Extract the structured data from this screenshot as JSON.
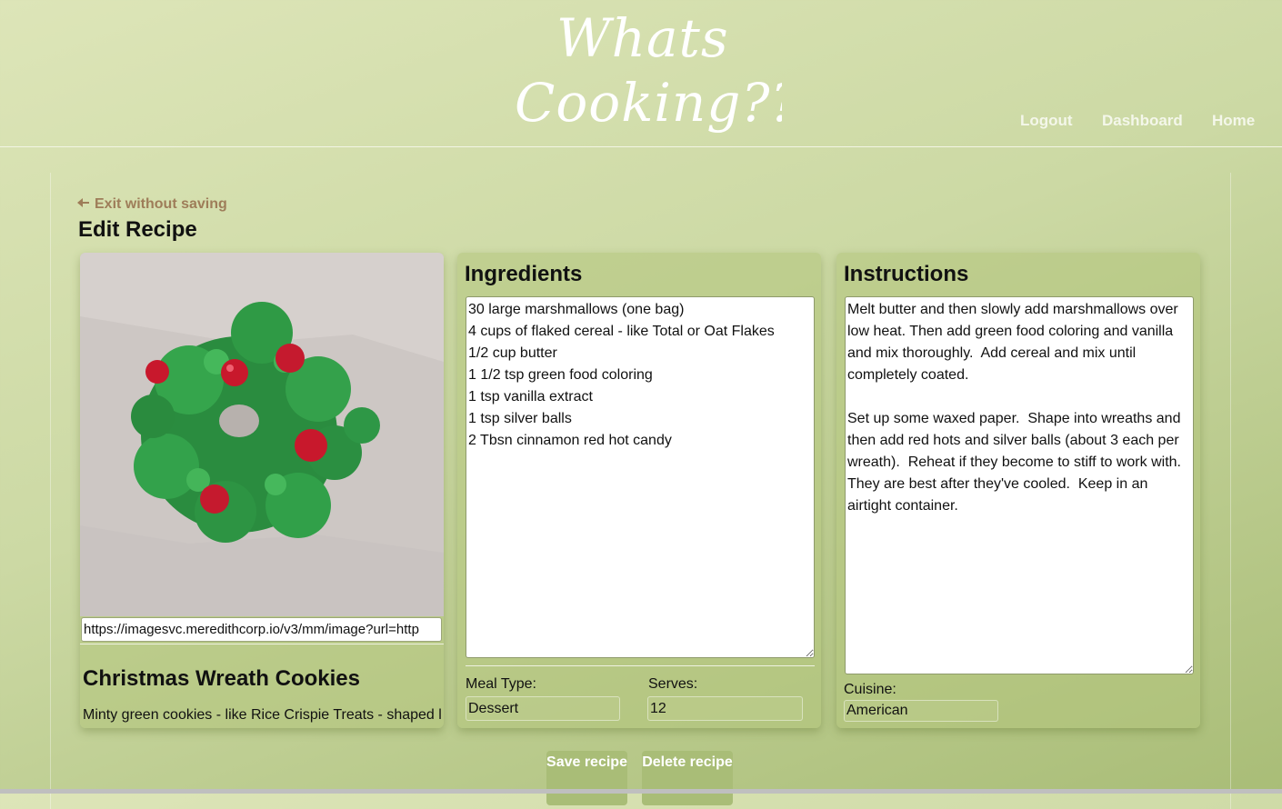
{
  "header": {
    "logo_line1": "Whats",
    "logo_line2": "Cooking??",
    "nav": [
      "Logout",
      "Dashboard",
      "Home"
    ]
  },
  "page": {
    "exit_label": "Exit without saving",
    "title": "Edit Recipe"
  },
  "recipe": {
    "image_url": "https://imagesvc.meredithcorp.io/v3/mm/image?url=http",
    "name": "Christmas Wreath Cookies",
    "description": "Minty green cookies - like Rice Crispie Treats - shaped like wreaths"
  },
  "ingredients": {
    "heading": "Ingredients",
    "text": "30 large marshmallows (one bag)\n4 cups of flaked cereal - like Total or Oat Flakes\n1/2 cup butter\n1 1/2 tsp green food coloring\n1 tsp vanilla extract\n1 tsp silver balls\n2 Tbsn cinnamon red hot candy"
  },
  "instructions": {
    "heading": "Instructions",
    "text": "Melt butter and then slowly add marshmallows over low heat. Then add green food coloring and vanilla and mix thoroughly.  Add cereal and mix until completely coated.\n\nSet up some waxed paper.  Shape into wreaths and then add red hots and silver balls (about 3 each per wreath).  Reheat if they become to stiff to work with.  They are best after they've cooled.  Keep in an airtight container."
  },
  "fields": {
    "meal_type_label": "Meal Type:",
    "meal_type_value": "Dessert",
    "serves_label": "Serves:",
    "serves_value": "12",
    "cuisine_label": "Cuisine:",
    "cuisine_value": "American"
  },
  "buttons": {
    "save": "Save recipe",
    "delete": "Delete recipe"
  },
  "colors": {
    "background": "#ccd9a4",
    "accent": "#a9bd77",
    "link": "#9e7d59"
  }
}
